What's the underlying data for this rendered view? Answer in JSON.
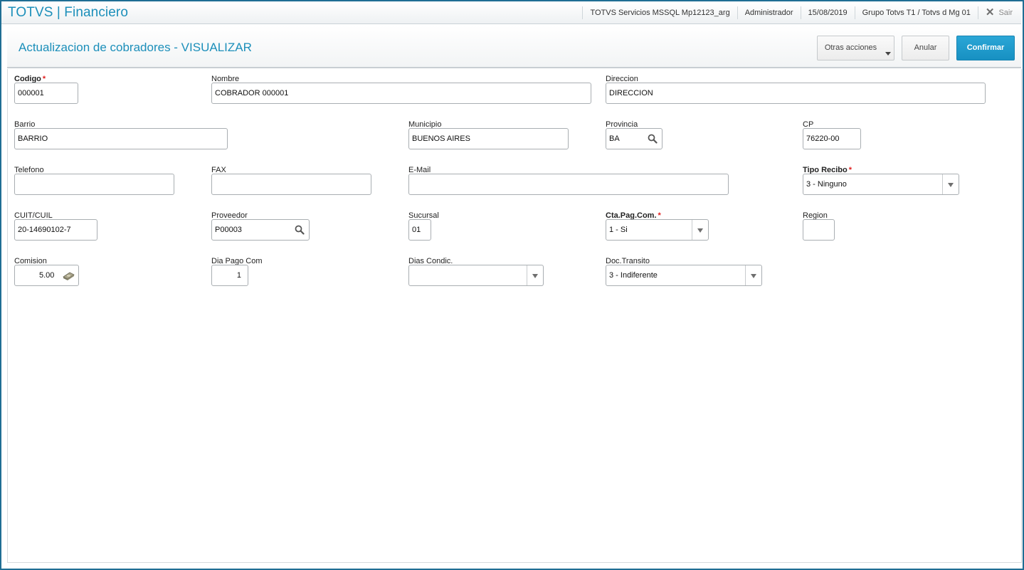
{
  "app": {
    "title": "TOTVS | Financiero"
  },
  "topbar": {
    "server": "TOTVS Servicios MSSQL Mp12123_arg",
    "user": "Administrador",
    "date": "15/08/2019",
    "company": "Grupo Totvs T1 / Totvs d Mg 01",
    "exit_label": "Sair"
  },
  "header": {
    "title": "Actualizacion de cobradores - VISUALIZAR",
    "other_actions_label": "Otras acciones",
    "cancel_label": "Anular",
    "confirm_label": "Confirmar"
  },
  "form": {
    "codigo": {
      "label": "Codigo",
      "value": "000001",
      "required": true
    },
    "nombre": {
      "label": "Nombre",
      "value": "COBRADOR 000001"
    },
    "direccion": {
      "label": "Direccion",
      "value": "DIRECCION"
    },
    "barrio": {
      "label": "Barrio",
      "value": "BARRIO"
    },
    "municipio": {
      "label": "Municipio",
      "value": "BUENOS AIRES"
    },
    "provincia": {
      "label": "Provincia",
      "value": "BA"
    },
    "cp": {
      "label": "CP",
      "value": "76220-00"
    },
    "telefono": {
      "label": "Telefono",
      "value": ""
    },
    "fax": {
      "label": "FAX",
      "value": ""
    },
    "email": {
      "label": "E-Mail",
      "value": ""
    },
    "tipo_recibo": {
      "label": "Tipo Recibo",
      "value": "3 - Ninguno",
      "required": true
    },
    "cuit": {
      "label": "CUIT/CUIL",
      "value": "20-14690102-7"
    },
    "proveedor": {
      "label": "Proveedor",
      "value": "P00003"
    },
    "sucursal": {
      "label": "Sucursal",
      "value": "01"
    },
    "cta_pag_com": {
      "label": "Cta.Pag.Com.",
      "value": "1 - Si",
      "required": true
    },
    "region": {
      "label": "Region",
      "value": ""
    },
    "comision": {
      "label": "Comision",
      "value": "5.00"
    },
    "dia_pago_com": {
      "label": "Dia Pago Com",
      "value": "1"
    },
    "dias_condic": {
      "label": "Dias Condic.",
      "value": ""
    },
    "doc_transito": {
      "label": "Doc.Transito",
      "value": "3 - Indiferente"
    }
  },
  "icons": {
    "lookup": "magnifier-icon",
    "calculator": "calculator-icon",
    "dropdown": "chevron-down-icon",
    "exit": "close-icon"
  },
  "colors": {
    "accent": "#1c8fba",
    "confirm_button": "#1f9bcc",
    "required_star": "#e02020",
    "frame_border": "#1f6e94"
  }
}
